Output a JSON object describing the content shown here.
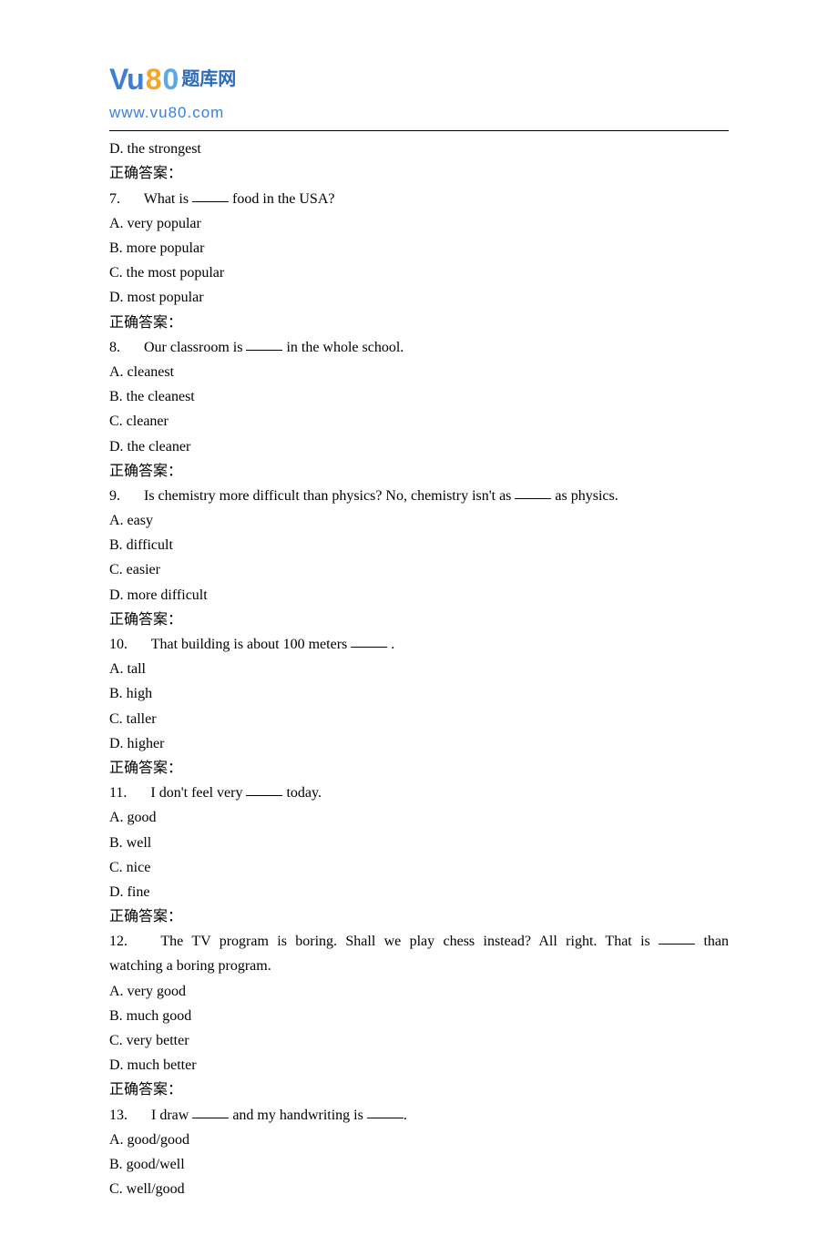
{
  "logo": {
    "part_vu": "Vu",
    "part_8": "8",
    "part_0": "0",
    "cn": "题库网",
    "url": "www.vu80.com"
  },
  "prev_option_d": "D. the strongest",
  "answer_label": "正确答案：",
  "questions": [
    {
      "num": "7.",
      "stem_before": "What is ",
      "stem_after": " food in the USA?",
      "options": [
        "A. very popular",
        "B. more popular",
        "C. the most popular",
        "D. most popular"
      ]
    },
    {
      "num": "8.",
      "stem_before": "Our classroom is ",
      "stem_after": " in the whole school.",
      "options": [
        "A. cleanest",
        "B. the cleanest",
        "C. cleaner",
        "D. the cleaner"
      ]
    },
    {
      "num": "9.",
      "stem_before": "Is chemistry more difficult than physics? No, chemistry isn't as ",
      "stem_after": " as physics.",
      "options": [
        "A. easy",
        "B. difficult",
        "C. easier",
        "D. more difficult"
      ]
    },
    {
      "num": "10.",
      "stem_before": "That building is about 100 meters ",
      "stem_after": " .",
      "options": [
        "A. tall",
        "B. high",
        "C. taller",
        "D. higher"
      ]
    },
    {
      "num": "11.",
      "stem_before": "I don't feel very ",
      "stem_after": " today.",
      "options": [
        "A. good",
        "B. well",
        "C. nice",
        "D. fine"
      ]
    },
    {
      "num": "12.",
      "stem_justified_line": "The TV program is boring. Shall we play chess instead? All right. That is ",
      "stem_justified_after": " than",
      "stem_last_line": "watching a boring program.",
      "options": [
        "A. very good",
        "B. much good",
        "C. very better",
        "D. much better"
      ]
    },
    {
      "num": "13.",
      "stem_before": "I draw ",
      "stem_mid": " and my handwriting is ",
      "stem_after": ".",
      "options": [
        "A. good/good",
        "B. good/well",
        "C. well/good"
      ]
    }
  ]
}
